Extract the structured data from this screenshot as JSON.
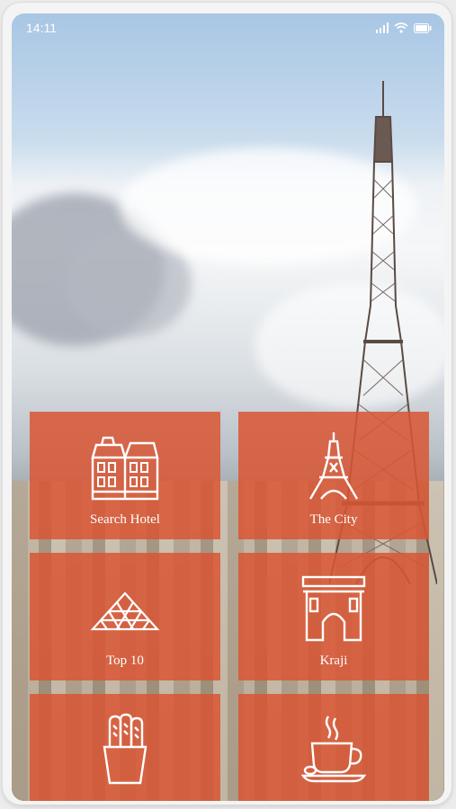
{
  "status_bar": {
    "time": "14:11",
    "icons": [
      "signal-icon",
      "wifi-icon",
      "battery-icon"
    ]
  },
  "background": {
    "scene": "eiffel-tower-over-paris",
    "tile_color": "#d95634"
  },
  "tiles": [
    {
      "label": "Search Hotel",
      "icon": "hotel-icon"
    },
    {
      "label": "The City",
      "icon": "eiffel-tower-icon"
    },
    {
      "label": "Top 10",
      "icon": "pyramid-icon"
    },
    {
      "label": "Kraji",
      "icon": "arc-de-triomphe-icon"
    },
    {
      "label": "",
      "icon": "baguette-icon"
    },
    {
      "label": "",
      "icon": "coffee-cup-icon"
    }
  ]
}
